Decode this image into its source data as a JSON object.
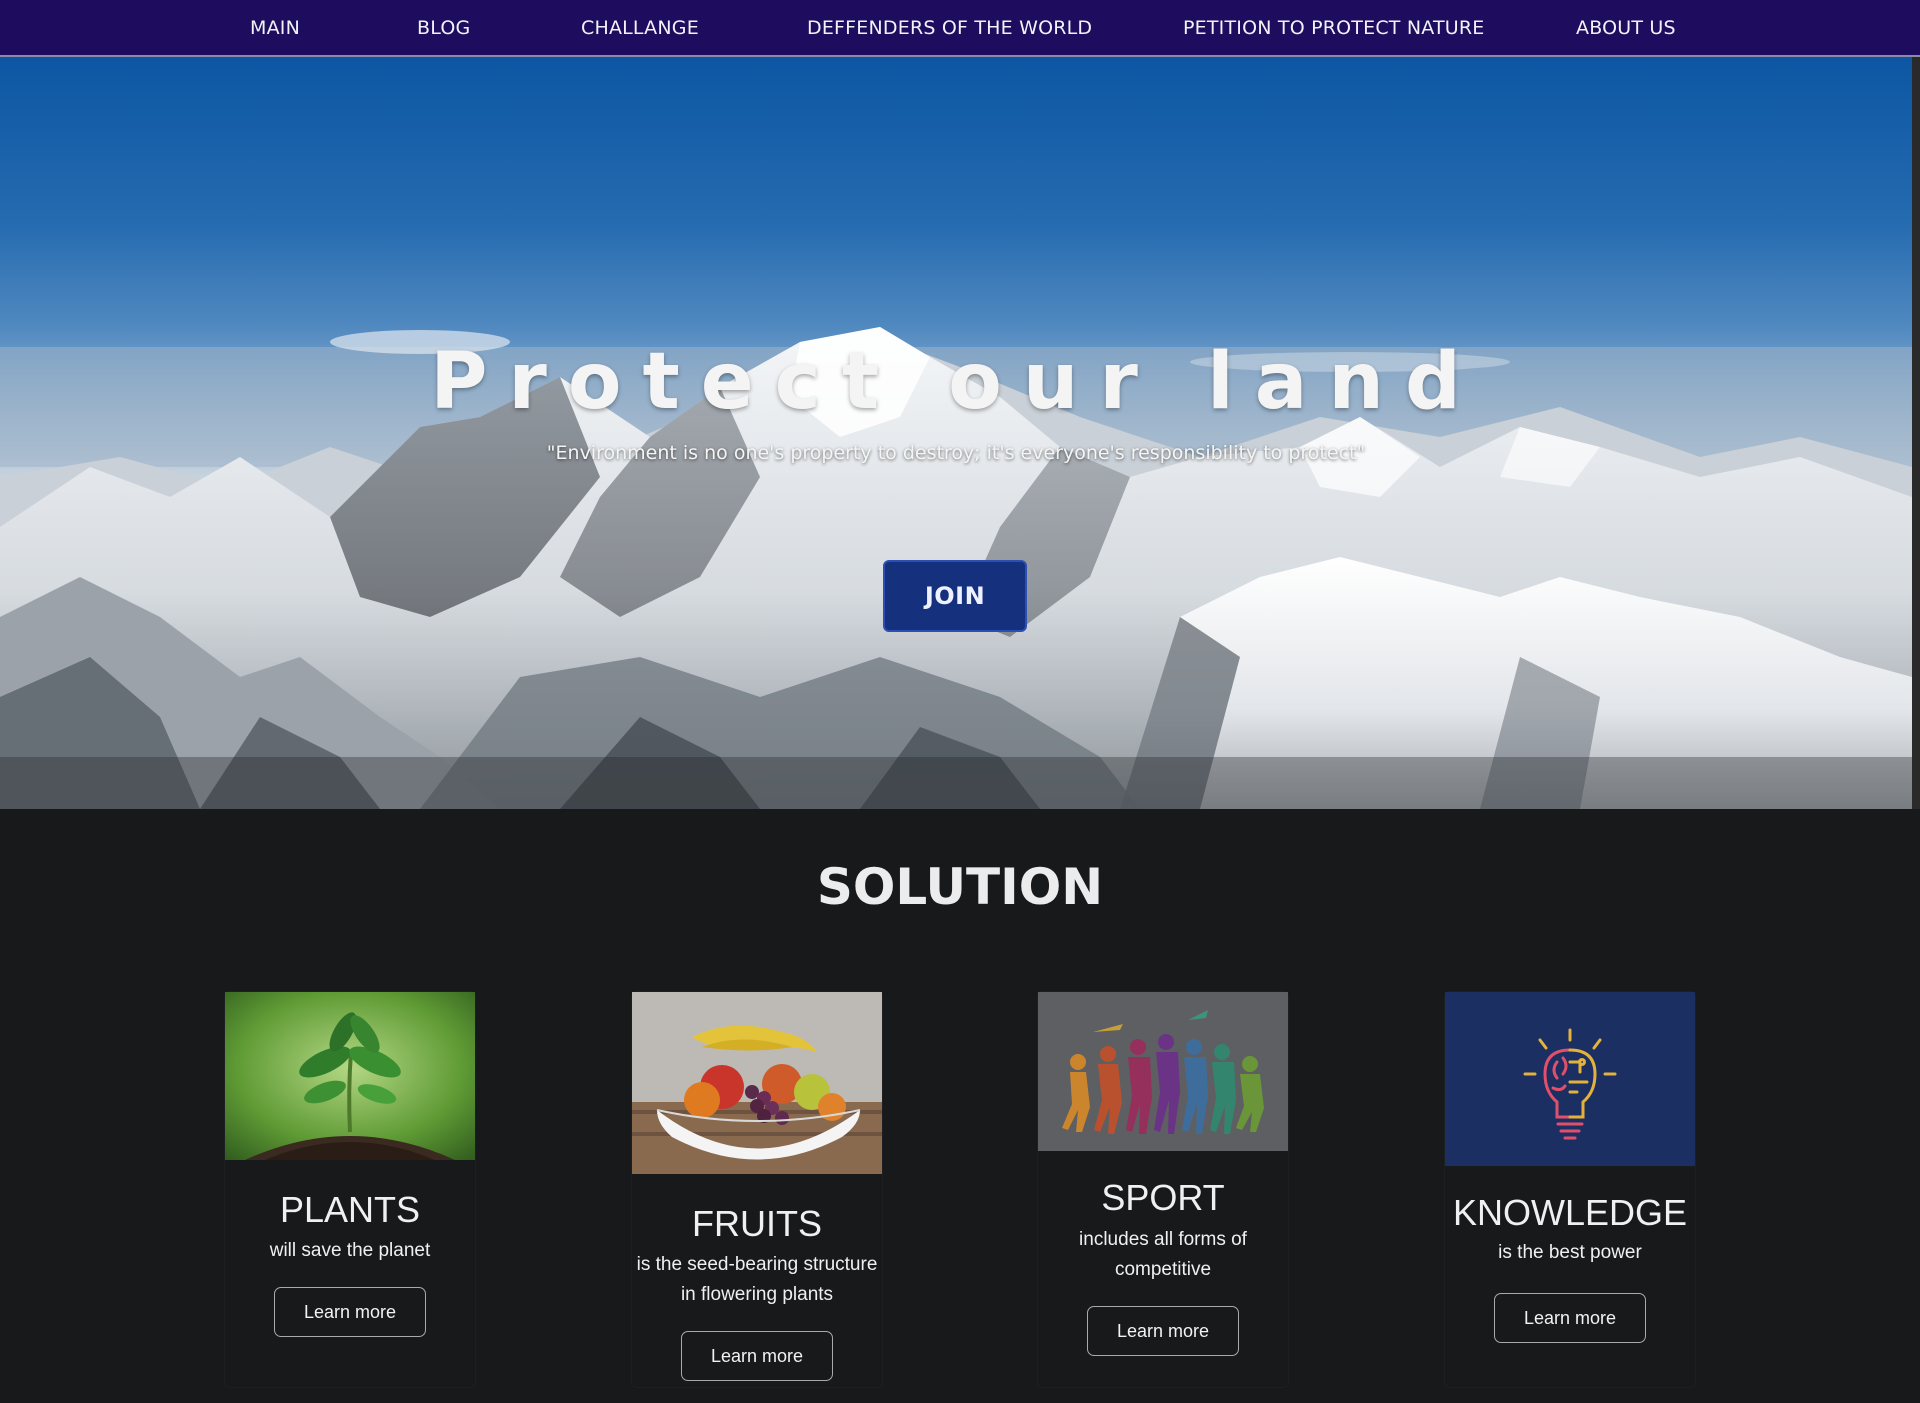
{
  "nav": {
    "items": [
      {
        "label": "MAIN"
      },
      {
        "label": "BLOG"
      },
      {
        "label": "CHALLANGE"
      },
      {
        "label": "DEFFENDERS OF THE WORLD"
      },
      {
        "label": "PETITION TO PROTECT NATURE"
      },
      {
        "label": "ABOUT US"
      }
    ]
  },
  "hero": {
    "title": "Protect our land",
    "subtitle": "\"Environment is no one's property to destroy; it's everyone's responsibility to protect\"",
    "join_label": "JOIN"
  },
  "solution": {
    "title": "SOLUTION",
    "cards": [
      {
        "title": "PLANTS",
        "text": "will save the planet",
        "button": "Learn more",
        "image_icon": "seedling-image"
      },
      {
        "title": "FRUITS",
        "text": "is the seed-bearing structure in flowering plants",
        "button": "Learn more",
        "image_icon": "fruit-bowl-image"
      },
      {
        "title": "SPORT",
        "text": "includes all forms of competitive",
        "button": "Learn more",
        "image_icon": "athletes-image"
      },
      {
        "title": "KNOWLEDGE",
        "text": "is the best power",
        "button": "Learn more",
        "image_icon": "lightbulb-brain-image"
      }
    ]
  },
  "colors": {
    "nav_bg": "#1e0d5e",
    "page_bg": "#17191b",
    "join_bg": "#15307c"
  }
}
